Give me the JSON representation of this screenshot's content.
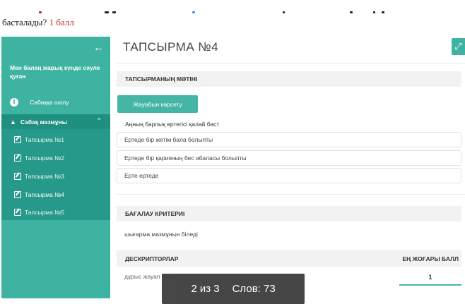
{
  "question_header": {
    "text": "басталады?",
    "points": "1 балл"
  },
  "sidebar": {
    "title": "Мен балаң жарық күнде сәуле қуған",
    "overview_label": "Сабаққа шолу",
    "content_label": "Сабақ мазмұны",
    "items": [
      {
        "label": "Тапсырма №1",
        "active": false
      },
      {
        "label": "Тапсырма №2",
        "active": false
      },
      {
        "label": "Тапсырма №3",
        "active": false
      },
      {
        "label": "Тапсырма №4",
        "active": true
      },
      {
        "label": "Тапсырма №5",
        "active": false
      }
    ]
  },
  "main": {
    "title": "ТАПСЫРМА №4",
    "task_section_title": "ТАПСЫРМАНЫҢ МӘТІНІ",
    "show_answer_button": "Жауабын көрсету",
    "question": "Аңның барлық ертегісі қалай баст",
    "options": [
      "Ертеде бір жетім бала болыпты",
      "Ертеде бір қарияның бес абаласы болыпты",
      "Ерте ертеде"
    ],
    "criteria_section_title": "БАҒАЛАУ КРИТЕРИІ",
    "criteria_text": "шығарма мазмұнын біледі",
    "descriptors_header": "ДЕСКРИПТОРЛАР",
    "max_score_header": "ЕҢ ЖОҒАРЫ БАЛЛ",
    "descriptor_row": "дұрыс жауап береді",
    "score_value": "1"
  },
  "status_overlay": {
    "page": "2 из 3",
    "words": "Слов: 73"
  },
  "colors": {
    "accent": "#3fb3a2",
    "accent_dark": "#1f8f80",
    "points_red": "#c62828"
  },
  "icons": {
    "back": "arrow-left-icon",
    "overview": "info-icon",
    "content": "graduation-cap-icon",
    "collapse": "chevron-up-icon",
    "task": "edit-icon",
    "expand": "expand-icon"
  }
}
